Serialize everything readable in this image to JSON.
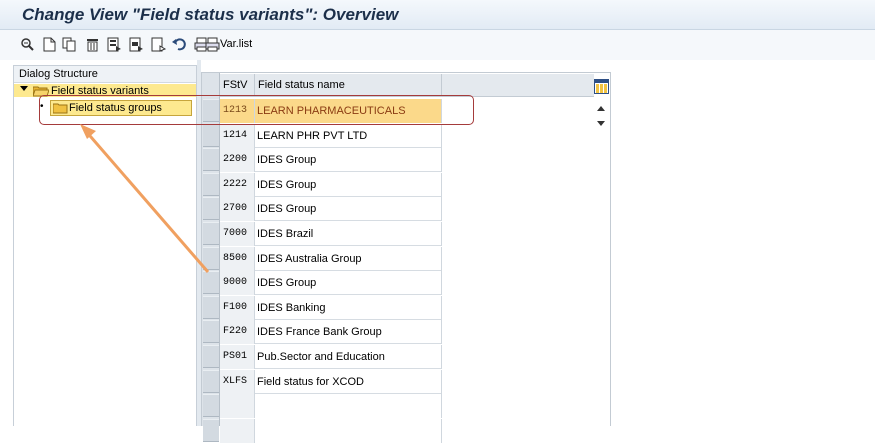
{
  "window": {
    "title": "Change View \"Field status variants\": Overview"
  },
  "toolbar": {
    "icons": [
      "display-change-icon",
      "new-entries-icon",
      "copy-as-icon",
      "delete-icon",
      "select-all-icon",
      "select-block-icon",
      "deselect-all-icon",
      "undo-change-icon",
      "print-icon",
      "print-icon"
    ],
    "var_list_label": "Var.list"
  },
  "dialog_structure": {
    "header": "Dialog Structure",
    "items": [
      {
        "label": "Field status variants",
        "expanded": true
      },
      {
        "label": "Field status groups",
        "selected": true
      }
    ]
  },
  "table": {
    "columns": [
      "FStV",
      "Field status name"
    ],
    "rows": [
      {
        "fstv": "1213",
        "name": "LEARN PHARMACEUTICALS",
        "selected": true
      },
      {
        "fstv": "1214",
        "name": "LEARN PHR PVT LTD"
      },
      {
        "fstv": "2200",
        "name": "IDES Group"
      },
      {
        "fstv": "2222",
        "name": "IDES Group"
      },
      {
        "fstv": "2700",
        "name": "IDES Group"
      },
      {
        "fstv": "7000",
        "name": "IDES Brazil"
      },
      {
        "fstv": "8500",
        "name": "IDES Australia Group"
      },
      {
        "fstv": "9000",
        "name": "IDES Group"
      },
      {
        "fstv": "F100",
        "name": "IDES Banking"
      },
      {
        "fstv": "F220",
        "name": "IDES France Bank Group"
      },
      {
        "fstv": "PS01",
        "name": "Pub.Sector and Education"
      },
      {
        "fstv": "XLFS",
        "name": "Field status for XCOD"
      }
    ]
  },
  "colors": {
    "title_text": "#1c2f4a",
    "selection": "#fbd98a",
    "tree_highlight": "#fde98f",
    "annotation_box": "#a53b3b",
    "annotation_arrow": "#f0a060"
  }
}
